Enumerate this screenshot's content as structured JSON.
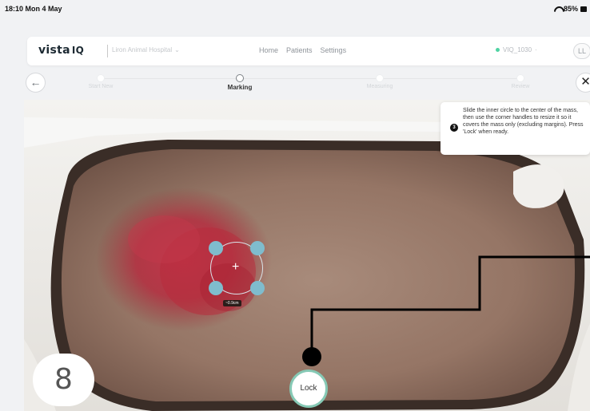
{
  "status_bar": {
    "time": "18:10  Mon 4 May",
    "battery": "85%"
  },
  "nav": {
    "logo": "vista",
    "logo_iq": "IQ",
    "clinic": "Liron Animal Hospital",
    "menu": [
      "Home",
      "Patients",
      "Settings"
    ],
    "device": "VIQ_1030",
    "device_sep": "·",
    "user_initials": "LL"
  },
  "stepper": {
    "steps": [
      {
        "label": "Start New"
      },
      {
        "label": "Marking"
      },
      {
        "label": "Measuring"
      },
      {
        "label": "Review"
      }
    ],
    "active_step": 2
  },
  "instruction": {
    "number": "3",
    "text": "Slide the inner circle to the center of the mass, then use the corner handles to resize it so it covers the mass only (excluding margins). Press 'Lock' when ready."
  },
  "marker": {
    "plus": "+",
    "size_label": "~0.9cm"
  },
  "lock_button": {
    "label": "Lock"
  },
  "tutorial": {
    "step_number": "8"
  },
  "colors": {
    "accent": "#7fbccd",
    "lock_ring": "#86c9b5",
    "status_dot": "#4fd3a3"
  },
  "icons": {
    "back": "arrow-left-icon",
    "close": "close-icon",
    "wifi": "wifi-icon",
    "battery": "battery-icon",
    "chevron": "chevron-down-icon"
  }
}
